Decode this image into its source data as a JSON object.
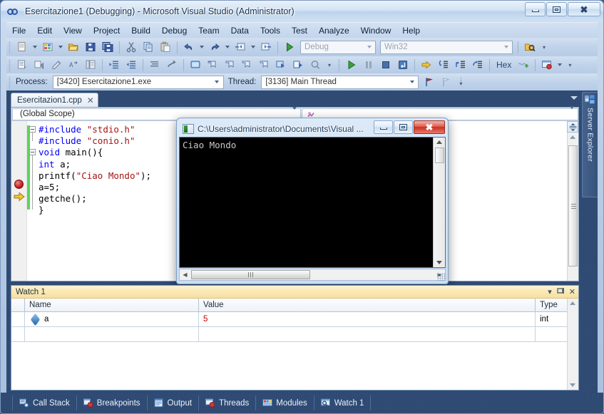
{
  "window": {
    "title": "Esercitazione1 (Debugging) - Microsoft Visual Studio (Administrator)",
    "app_icon": "visual-studio-icon",
    "minimize_label": "Minimize",
    "maximize_label": "Maximize",
    "close_label": "Close"
  },
  "menu": {
    "items": [
      {
        "label": "File"
      },
      {
        "label": "Edit"
      },
      {
        "label": "View"
      },
      {
        "label": "Project"
      },
      {
        "label": "Build"
      },
      {
        "label": "Debug"
      },
      {
        "label": "Team"
      },
      {
        "label": "Data"
      },
      {
        "label": "Tools"
      },
      {
        "label": "Test"
      },
      {
        "label": "Analyze"
      },
      {
        "label": "Window"
      },
      {
        "label": "Help"
      }
    ]
  },
  "standard_toolbar": {
    "buttons": [
      {
        "name": "new-item-icon"
      },
      {
        "name": "new-project-icon"
      },
      {
        "name": "open-file-icon"
      },
      {
        "name": "save-icon"
      },
      {
        "name": "save-all-icon"
      },
      {
        "name": "cut-icon"
      },
      {
        "name": "copy-icon"
      },
      {
        "name": "paste-icon"
      },
      {
        "name": "undo-icon"
      },
      {
        "name": "redo-icon"
      },
      {
        "name": "navigate-backward-icon"
      },
      {
        "name": "navigate-forward-icon"
      },
      {
        "name": "start-debugging-icon"
      }
    ],
    "config_value": "Debug",
    "platform_value": "Win32",
    "find_icon": "find-in-files-icon"
  },
  "text_editor_toolbar": {
    "buttons": [
      {
        "name": "display-class-view-icon"
      },
      {
        "name": "quick-find-symbol-icon"
      },
      {
        "name": "insert-snippet-icon"
      },
      {
        "name": "toggle-word-wrap-icon"
      },
      {
        "name": "comment-block-icon"
      },
      {
        "name": "increase-indent-icon"
      },
      {
        "name": "decrease-indent-icon"
      },
      {
        "name": "uncomment-icon"
      },
      {
        "name": "toggle-outlining-icon"
      },
      {
        "name": "toggle-bookmark-icon"
      },
      {
        "name": "previous-bookmark-icon"
      },
      {
        "name": "next-bookmark-icon"
      },
      {
        "name": "prev-bookmark-folder-icon"
      },
      {
        "name": "next-bookmark-folder-icon"
      },
      {
        "name": "clear-bookmarks-icon"
      },
      {
        "name": "add-bookmark-icon"
      },
      {
        "name": "search-bookmarks-icon"
      }
    ]
  },
  "debug_toolbar": {
    "process_label": "Process:",
    "process_value": "[3420] Esercitazione1.exe",
    "thread_label": "Thread:",
    "thread_value": "[3136] Main Thread",
    "buttons": [
      {
        "name": "continue-icon"
      },
      {
        "name": "break-all-icon"
      },
      {
        "name": "stop-debugging-icon"
      },
      {
        "name": "restart-icon"
      },
      {
        "name": "show-next-statement-icon"
      },
      {
        "name": "step-into-icon"
      },
      {
        "name": "step-over-icon"
      },
      {
        "name": "step-out-icon"
      }
    ],
    "hex_label": "Hex",
    "hex_toggle_icon": "hexadecimal-display-icon",
    "threads_icon": "threads-window-icon",
    "breakpoint-flag-icon": "breakpoint-flag-icon"
  },
  "document_tabs": [
    {
      "label": "Esercitazion1.cpp",
      "close_icon": "close-tab-icon",
      "active": true
    }
  ],
  "editor": {
    "scope_value": "(Global Scope)",
    "member_value": "",
    "breakpoint_marker": "breakpoint-icon",
    "current_line_marker": "current-statement-arrow-icon",
    "code_lines": [
      "#include \"stdio.h\"",
      "#include \"conio.h\"",
      "void main(){",
      "int a;",
      "printf(\"Ciao Mondo\");",
      "a=5;",
      "getche();",
      "}"
    ]
  },
  "tool_windows": {
    "server_explorer_label": "Server Explorer",
    "server_explorer_icon": "server-explorer-icon"
  },
  "console_window": {
    "title": "C:\\Users\\administrator\\Documents\\Visual ...",
    "icon": "console-window-icon",
    "output": "Ciao Mondo",
    "minimize_label": "Minimize",
    "maximize_label": "Maximize",
    "close_label": "Close"
  },
  "watch_panel": {
    "title": "Watch 1",
    "dropdown_icon": "window-menu-icon",
    "pin_icon": "auto-hide-pin-icon",
    "close_icon": "close-panel-icon",
    "columns": [
      "",
      "Name",
      "Value",
      "Type"
    ],
    "rows": [
      {
        "icon": "watch-variable-icon",
        "name": "a",
        "value": "5",
        "type": "int"
      },
      {
        "icon": "",
        "name": "",
        "value": "",
        "type": ""
      }
    ]
  },
  "bottom_tabs": [
    {
      "label": "Call Stack",
      "icon": "call-stack-icon"
    },
    {
      "label": "Breakpoints",
      "icon": "breakpoints-icon"
    },
    {
      "label": "Output",
      "icon": "output-window-icon"
    },
    {
      "label": "Threads",
      "icon": "threads-icon"
    },
    {
      "label": "Modules",
      "icon": "modules-icon"
    },
    {
      "label": "Watch 1",
      "icon": "watch-icon"
    }
  ],
  "colors": {
    "keyword": "#0000ff",
    "string": "#a31515",
    "value_red": "#c00000",
    "chrome_blue": "#2e4a73",
    "watch_header": "#fae8b4"
  }
}
